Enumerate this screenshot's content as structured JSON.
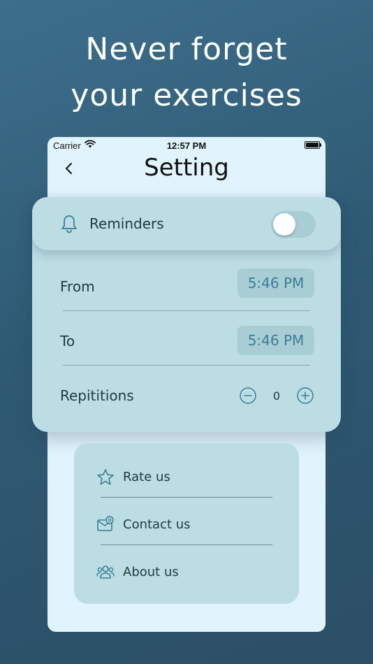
{
  "headline": {
    "line1": "Never forget",
    "line2": "your exercises"
  },
  "status_bar": {
    "carrier": "Carrier",
    "time": "12:57 PM"
  },
  "header": {
    "title": "Setting"
  },
  "reminders": {
    "label": "Reminders",
    "enabled": false,
    "from_label": "From",
    "from_time": "5:46 PM",
    "to_label": "To",
    "to_time": "5:46 PM",
    "repetitions_label": "Repititions",
    "repetitions_value": "0"
  },
  "links": [
    {
      "label": "Rate us",
      "icon": "star-icon"
    },
    {
      "label": "Contact us",
      "icon": "contact-mail-icon"
    },
    {
      "label": "About us",
      "icon": "people-icon"
    }
  ],
  "colors": {
    "accent": "#3a7e93",
    "card": "#bcdde4",
    "phone_bg": "#e1f3fc"
  }
}
